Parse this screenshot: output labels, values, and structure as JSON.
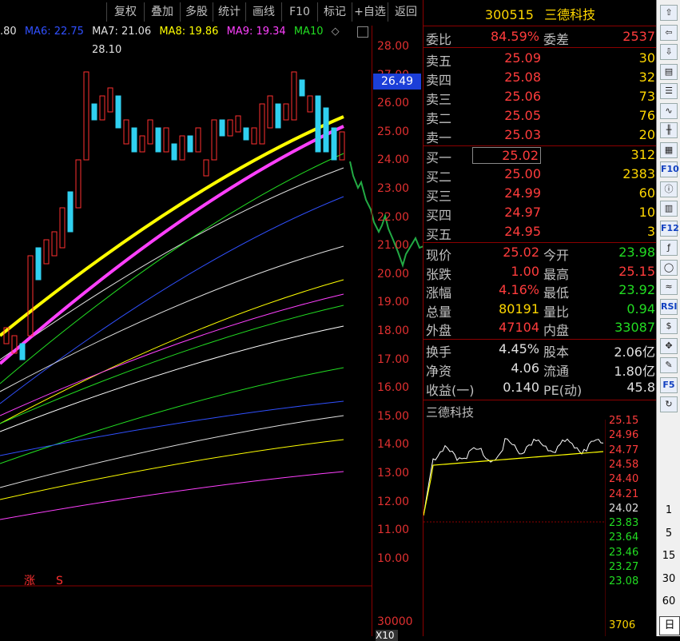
{
  "toolbar": {
    "items": [
      "复权",
      "叠加",
      "多股",
      "统计",
      "画线",
      "F10",
      "标记",
      "+自选",
      "返回"
    ]
  },
  "ma_legend": [
    {
      "label": ".80",
      "color": "#e0e0e0"
    },
    {
      "label": "MA6: 22.75",
      "color": "#3050ff"
    },
    {
      "label": "MA7: 21.06",
      "color": "#e0e0e0"
    },
    {
      "label": "MA8: 19.86",
      "color": "#ffff00"
    },
    {
      "label": "MA9: 19.34",
      "color": "#ff40ff"
    },
    {
      "label": "MA10",
      "color": "#22dd22"
    }
  ],
  "price_axis": {
    "ticks": [
      "28.00",
      "27.00",
      "26.00",
      "25.00",
      "24.00",
      "23.00",
      "22.00",
      "21.00",
      "20.00",
      "19.00",
      "18.00",
      "17.00",
      "16.00",
      "15.00",
      "14.00",
      "13.00",
      "12.00",
      "11.00",
      "10.00"
    ],
    "current_tag": "26.49",
    "volume_tick": "30000",
    "volume_tag": "X10"
  },
  "chart_annotations": {
    "high_label": "28.10",
    "badge_zhang": "涨",
    "badge_s": "S"
  },
  "stock": {
    "code": "300515",
    "name": "三德科技"
  },
  "committee": {
    "ratio_label": "委比",
    "ratio": "84.59%",
    "diff_label": "委差",
    "diff": "2537"
  },
  "asks": [
    {
      "label": "卖五",
      "price": "25.09",
      "vol": "30"
    },
    {
      "label": "卖四",
      "price": "25.08",
      "vol": "32"
    },
    {
      "label": "卖三",
      "price": "25.06",
      "vol": "73"
    },
    {
      "label": "卖二",
      "price": "25.05",
      "vol": "76"
    },
    {
      "label": "卖一",
      "price": "25.03",
      "vol": "20"
    }
  ],
  "bids": [
    {
      "label": "买一",
      "price": "25.02",
      "vol": "312"
    },
    {
      "label": "买二",
      "price": "25.00",
      "vol": "2383"
    },
    {
      "label": "买三",
      "price": "24.99",
      "vol": "60"
    },
    {
      "label": "买四",
      "price": "24.97",
      "vol": "10"
    },
    {
      "label": "买五",
      "price": "24.95",
      "vol": "3"
    }
  ],
  "quote": [
    {
      "l1": "现价",
      "v1": "25.02",
      "c1": "red",
      "l2": "今开",
      "v2": "23.98",
      "c2": "green"
    },
    {
      "l1": "张跌",
      "v1": "1.00",
      "c1": "red",
      "l2": "最高",
      "v2": "25.15",
      "c2": "red"
    },
    {
      "l1": "涨幅",
      "v1": "4.16%",
      "c1": "red",
      "l2": "最低",
      "v2": "23.92",
      "c2": "green"
    },
    {
      "l1": "总量",
      "v1": "80191",
      "c1": "yellow",
      "l2": "量比",
      "v2": "0.94",
      "c2": "green"
    },
    {
      "l1": "外盘",
      "v1": "47104",
      "c1": "red",
      "l2": "内盘",
      "v2": "33087",
      "c2": "green"
    }
  ],
  "fundamentals": [
    {
      "l1": "换手",
      "v1": "4.45%",
      "l2": "股本",
      "v2": "2.06亿"
    },
    {
      "l1": "净资",
      "v1": "4.06",
      "l2": "流通",
      "v2": "1.80亿"
    },
    {
      "l1": "收益(一)",
      "v1": "0.140",
      "l2": "PE(动)",
      "v2": "45.8"
    }
  ],
  "mini_chart": {
    "title": "三德科技",
    "ticks": [
      {
        "t": "25.15",
        "c": "red"
      },
      {
        "t": "24.96",
        "c": "red"
      },
      {
        "t": "24.77",
        "c": "red"
      },
      {
        "t": "24.58",
        "c": "red"
      },
      {
        "t": "24.40",
        "c": "red"
      },
      {
        "t": "24.21",
        "c": "red"
      },
      {
        "t": "24.02",
        "c": "white"
      },
      {
        "t": "23.83",
        "c": "green"
      },
      {
        "t": "23.64",
        "c": "green"
      },
      {
        "t": "23.46",
        "c": "green"
      },
      {
        "t": "23.27",
        "c": "green"
      },
      {
        "t": "23.08",
        "c": "green"
      }
    ],
    "volume_tick": "3706"
  },
  "sidebar": {
    "icons": [
      "up-arrow-icon",
      "left-arrow-icon",
      "down-arrow-icon",
      "table-icon",
      "list-icon",
      "line-chart-icon",
      "kline-icon",
      "report-icon",
      "f10-icon",
      "info-icon",
      "doc-icon",
      "f12-icon",
      "fx-icon",
      "circle-icon",
      "wave-icon",
      "rsi-icon",
      "dollar-icon",
      "move-icon",
      "pencil-icon",
      "f5-icon",
      "refresh-icon"
    ],
    "labels": {
      "rsi": "RSI",
      "f5": "F5",
      "f10": "F10",
      "f12": "F12"
    },
    "periods": [
      "1",
      "5",
      "15",
      "30",
      "60",
      "日"
    ]
  }
}
